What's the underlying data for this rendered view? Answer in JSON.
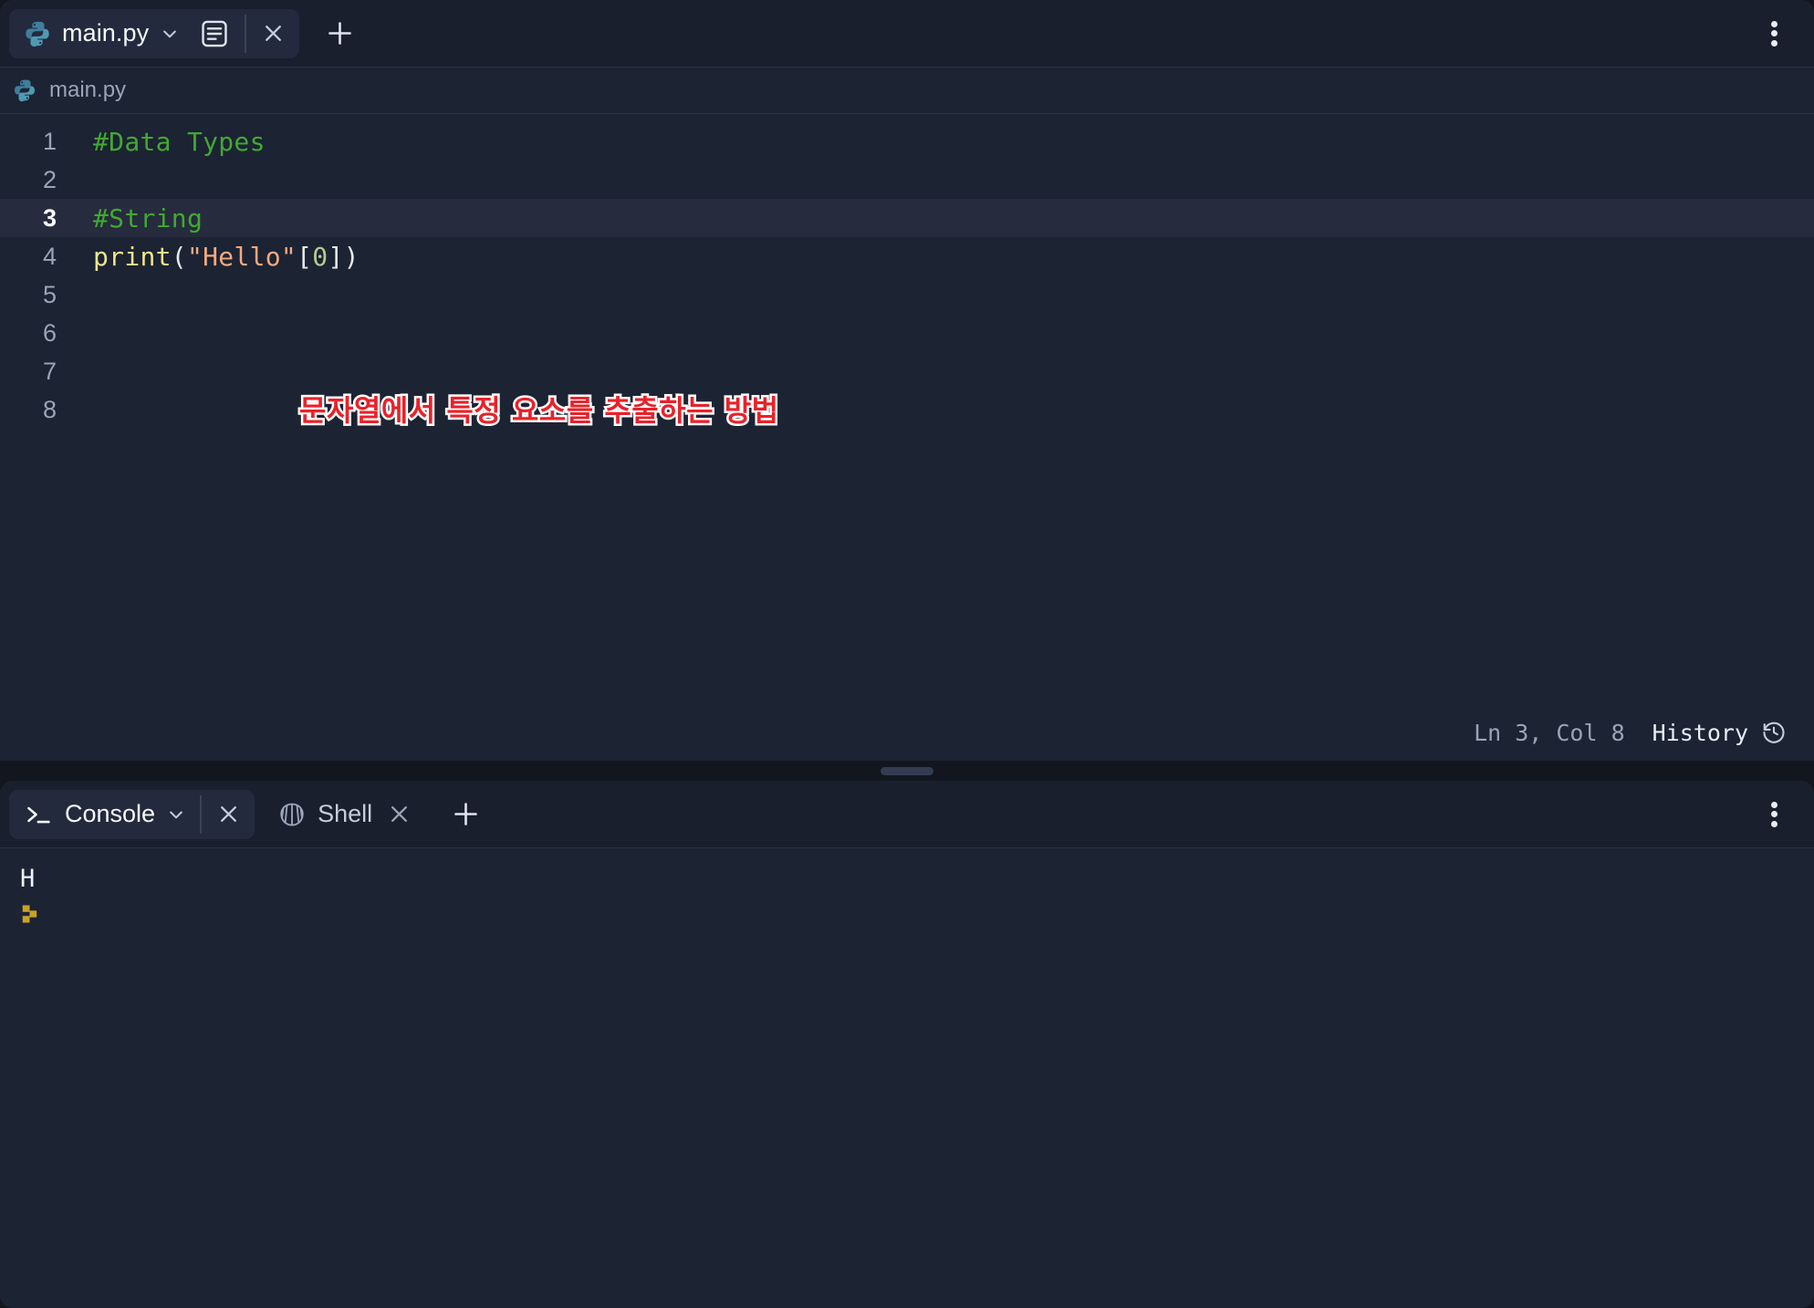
{
  "app": {
    "theme_accent": "#1c2333",
    "outer_bg": "#13161f",
    "tabstrip_bg": "#1a1f2e",
    "active_tab_bg": "#242a3d"
  },
  "editor": {
    "tab": {
      "filename": "main.py",
      "file_icon": "python-logo-icon",
      "dropdown_icon": "chevron-down-icon",
      "doc_icon": "document-lines-icon",
      "close_icon": "close-icon"
    },
    "new_tab_icon": "plus-icon",
    "kebab_icon": "more-vertical-icon",
    "breadcrumb": {
      "icon": "python-logo-icon",
      "path": "main.py"
    },
    "lines": [
      {
        "num": "1",
        "active": false,
        "tokens": [
          {
            "t": "#Data Types",
            "c": "c-comment"
          }
        ]
      },
      {
        "num": "2",
        "active": false,
        "tokens": []
      },
      {
        "num": "3",
        "active": true,
        "tokens": [
          {
            "t": "#String",
            "c": "c-comment"
          }
        ]
      },
      {
        "num": "4",
        "active": false,
        "tokens": [
          {
            "t": "print",
            "c": "c-fn"
          },
          {
            "t": "(",
            "c": "c-punc"
          },
          {
            "t": "\"Hello\"",
            "c": "c-str"
          },
          {
            "t": "[",
            "c": "c-punc"
          },
          {
            "t": "0",
            "c": "c-num"
          },
          {
            "t": "]",
            "c": "c-punc"
          },
          {
            "t": ")",
            "c": "c-punc"
          }
        ]
      },
      {
        "num": "5",
        "active": false,
        "tokens": []
      },
      {
        "num": "6",
        "active": false,
        "tokens": []
      },
      {
        "num": "7",
        "active": false,
        "tokens": []
      },
      {
        "num": "8",
        "active": false,
        "tokens": []
      }
    ],
    "annotation": {
      "text": "문자열에서 특정 요소를 추출하는 방법",
      "fill_color": "#e8222a",
      "stroke_color": "#ffffff"
    },
    "status": {
      "cursor_position": "Ln 3, Col 8",
      "history_label": "History",
      "history_icon": "history-clock-icon"
    }
  },
  "splitter": {
    "handle_name": "panel-resize-handle"
  },
  "console": {
    "tabs": [
      {
        "label": "Console",
        "icon": "terminal-prompt-icon",
        "active": true,
        "dropdown_icon": "chevron-down-icon",
        "close_icon": "close-icon"
      },
      {
        "label": "Shell",
        "icon": "seashell-icon",
        "active": false,
        "close_icon": "close-icon"
      }
    ],
    "add_tab_icon": "plus-icon",
    "kebab_icon": "more-vertical-icon",
    "output": "H",
    "prompt_icon": "replit-prompt-icon",
    "prompt_color": "#c9a227"
  }
}
